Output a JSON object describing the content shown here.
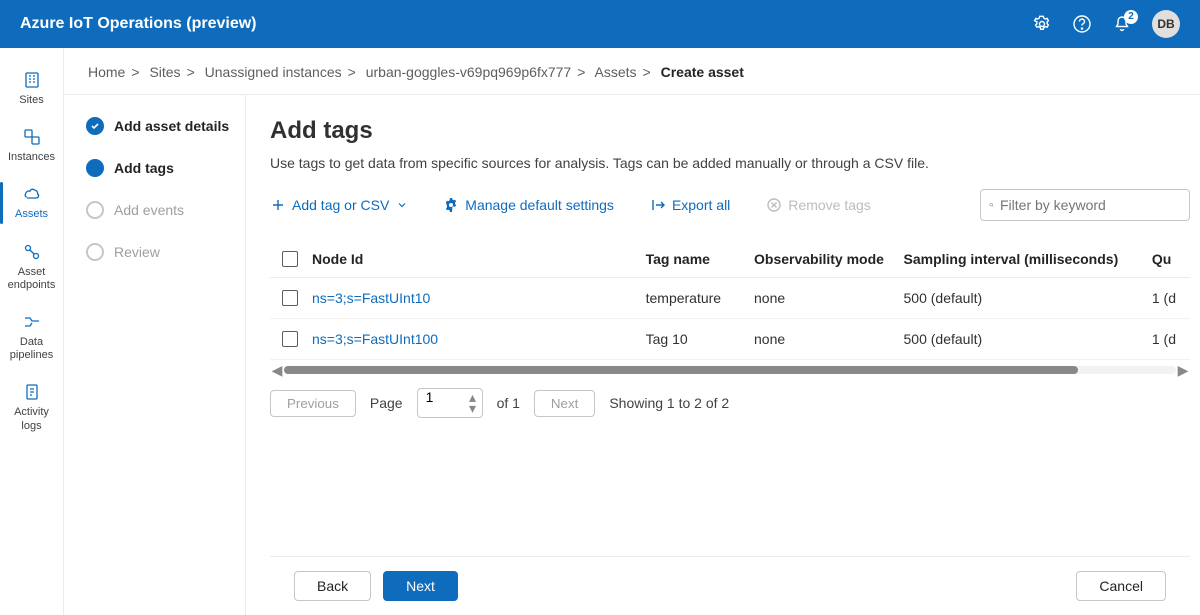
{
  "header": {
    "product": "Azure IoT Operations (preview)",
    "notif_count": "2",
    "avatar": "DB"
  },
  "leftnav": [
    {
      "label": "Sites"
    },
    {
      "label": "Instances"
    },
    {
      "label": "Assets"
    },
    {
      "label": "Asset endpoints"
    },
    {
      "label": "Data pipelines"
    },
    {
      "label": "Activity logs"
    }
  ],
  "breadcrumb": [
    "Home",
    "Sites",
    "Unassigned instances",
    "urban-goggles-v69pq969p6fx777",
    "Assets",
    "Create asset"
  ],
  "steps": [
    {
      "label": "Add asset details",
      "state": "done"
    },
    {
      "label": "Add tags",
      "state": "current"
    },
    {
      "label": "Add events",
      "state": ""
    },
    {
      "label": "Review",
      "state": ""
    }
  ],
  "page": {
    "title": "Add tags",
    "desc": "Use tags to get data from specific sources for analysis. Tags can be added manually or through a CSV file.",
    "toolbar": {
      "add": "Add tag or CSV",
      "manage": "Manage default settings",
      "export": "Export all",
      "remove": "Remove tags",
      "filter_placeholder": "Filter by keyword"
    },
    "columns": {
      "node": "Node Id",
      "tag": "Tag name",
      "obs": "Observability mode",
      "samp": "Sampling interval (milliseconds)",
      "queue": "Qu"
    },
    "rows": [
      {
        "node": "ns=3;s=FastUInt10",
        "tag": "temperature",
        "obs": "none",
        "samp": "500 (default)",
        "queue": "1 (d"
      },
      {
        "node": "ns=3;s=FastUInt100",
        "tag": "Tag 10",
        "obs": "none",
        "samp": "500 (default)",
        "queue": "1 (d"
      }
    ],
    "pager": {
      "prev": "Previous",
      "next": "Next",
      "page_label": "Page",
      "page_value": "1",
      "total_label": "of 1",
      "showing": "Showing 1 to 2 of 2"
    }
  },
  "footer": {
    "back": "Back",
    "next": "Next",
    "cancel": "Cancel"
  }
}
